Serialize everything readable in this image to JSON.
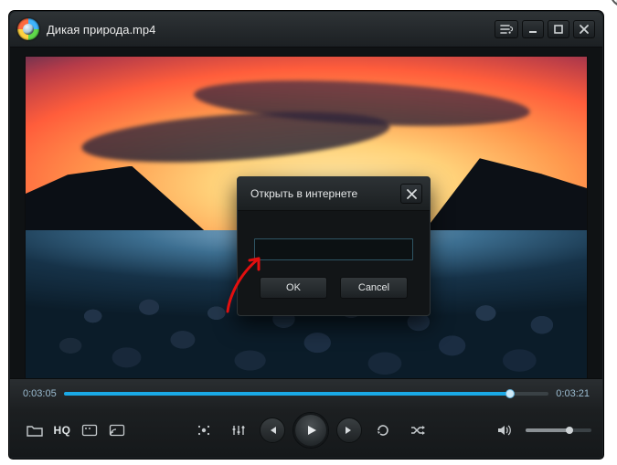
{
  "window": {
    "title": "Дикая природа.mp4"
  },
  "playback": {
    "current_time": "0:03:05",
    "total_time": "0:03:21",
    "progress_pct": 92,
    "volume_pct": 66
  },
  "controls": {
    "hq_label": "HQ"
  },
  "modal": {
    "title": "Открыть в интернете",
    "url_value": "",
    "ok_label": "OK",
    "cancel_label": "Cancel"
  },
  "colors": {
    "accent": "#1aa9e6"
  }
}
